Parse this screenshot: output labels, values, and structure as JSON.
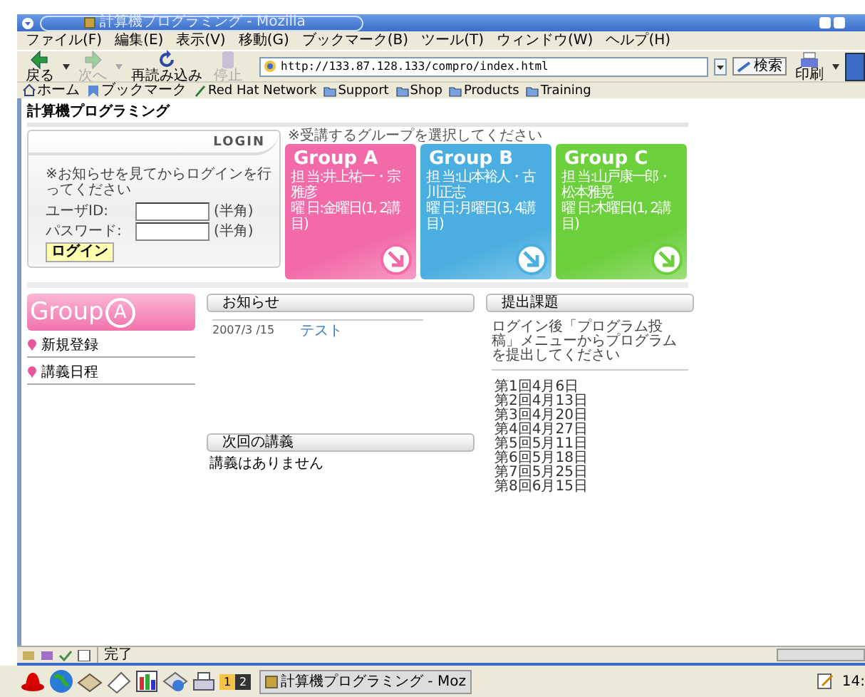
{
  "window": {
    "title": "計算機プログラミング - Mozilla"
  },
  "menu": [
    "ファイル(F)",
    "編集(E)",
    "表示(V)",
    "移動(G)",
    "ブックマーク(B)",
    "ツール(T)",
    "ウィンドウ(W)",
    "ヘルプ(H)"
  ],
  "toolbar": [
    {
      "kind": "back",
      "label": "戻る",
      "disabled": false
    },
    {
      "kind": "forward",
      "label": "次へ",
      "disabled": true
    },
    {
      "kind": "reload",
      "label": "再読み込み",
      "disabled": false
    },
    {
      "kind": "stop",
      "label": "停止",
      "disabled": true
    }
  ],
  "address": {
    "url": "http://133.87.128.133/compro/index.html"
  },
  "search_button": "検索",
  "print_button": "印刷",
  "bookmarks": [
    {
      "kind": "home",
      "label": "ホーム"
    },
    {
      "kind": "bookmarks",
      "label": "ブックマーク"
    },
    {
      "kind": "pen",
      "label": "Red Hat Network"
    },
    {
      "kind": "folder",
      "label": "Support"
    },
    {
      "kind": "folder",
      "label": "Shop"
    },
    {
      "kind": "folder",
      "label": "Products"
    },
    {
      "kind": "folder",
      "label": "Training"
    }
  ],
  "page": {
    "title": "計算機プログラミング",
    "login": {
      "heading": "LOGIN",
      "note": "※お知らせを見てからログインを行ってください",
      "fields": [
        {
          "label": "ユーザID:",
          "hint": "(半角)"
        },
        {
          "label": "パスワード:",
          "hint": "(半角)"
        }
      ],
      "button": "ログイン"
    },
    "group_caption": "※受講するグループを選択してください",
    "groups": [
      {
        "name": "Group A",
        "color": "#f26aa8",
        "teacher": "担 当:井上祐一・宗雅彦",
        "day": "曜 日:金曜日(1, 2講目)"
      },
      {
        "name": "Group B",
        "color": "#4aaee0",
        "teacher": "担 当:山本裕人・古川正志",
        "day": "曜 日:月曜日(3, 4講目)"
      },
      {
        "name": "Group C",
        "color": "#6ccf3c",
        "teacher": "担 当:山戸康一郎・松本雅晃",
        "day": "曜 日:木曜日(1, 2講目)"
      }
    ],
    "banner": {
      "word": "Group",
      "letter": "A"
    },
    "side_menu": [
      "新規登録",
      "講義日程"
    ],
    "news": {
      "heading": "お知らせ",
      "items": [
        {
          "date": "2007/3 /15",
          "title": "テスト"
        }
      ]
    },
    "next_lecture": {
      "heading": "次回の講義",
      "text": "講義はありません"
    },
    "assignments": {
      "heading": "提出課題",
      "note": "ログイン後「プログラム投稿」メニューからプログラムを提出してください",
      "items": [
        "第1回4月6日",
        "第2回4月13日",
        "第3回4月20日",
        "第4回4月27日",
        "第5回5月11日",
        "第6回5月18日",
        "第7回5月25日",
        "第8回6月15日"
      ]
    }
  },
  "status_bar": {
    "text": "完了"
  },
  "taskbar": {
    "workspaces": [
      {
        "label": "1",
        "selected": true
      },
      {
        "label": "2",
        "selected": false
      }
    ],
    "tasks": [
      "計算機プログラミング - Moz"
    ],
    "clock": "14:"
  }
}
